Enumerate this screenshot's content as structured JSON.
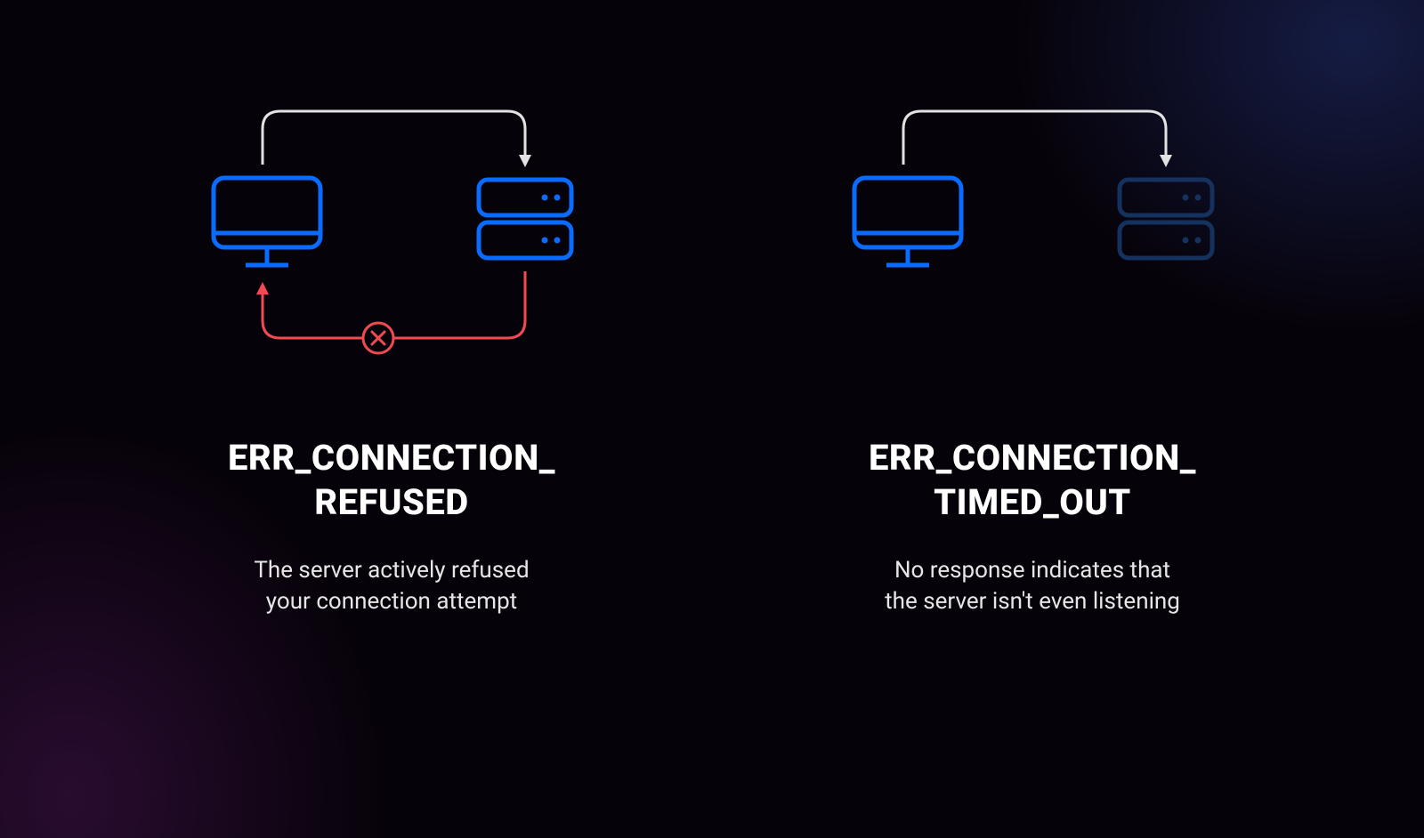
{
  "left": {
    "title": "ERR_CONNECTION_\nREFUSED",
    "desc": "The server actively refused\nyour connection attempt"
  },
  "right": {
    "title": "ERR_CONNECTION_\nTIMED_OUT",
    "desc": "No response indicates that\nthe server isn't even listening"
  },
  "colors": {
    "accent": "#0a6cff",
    "accentDim": "#15315e",
    "error": "#f14a53",
    "arrow": "#e2e2e2",
    "text": "#ffffff"
  }
}
